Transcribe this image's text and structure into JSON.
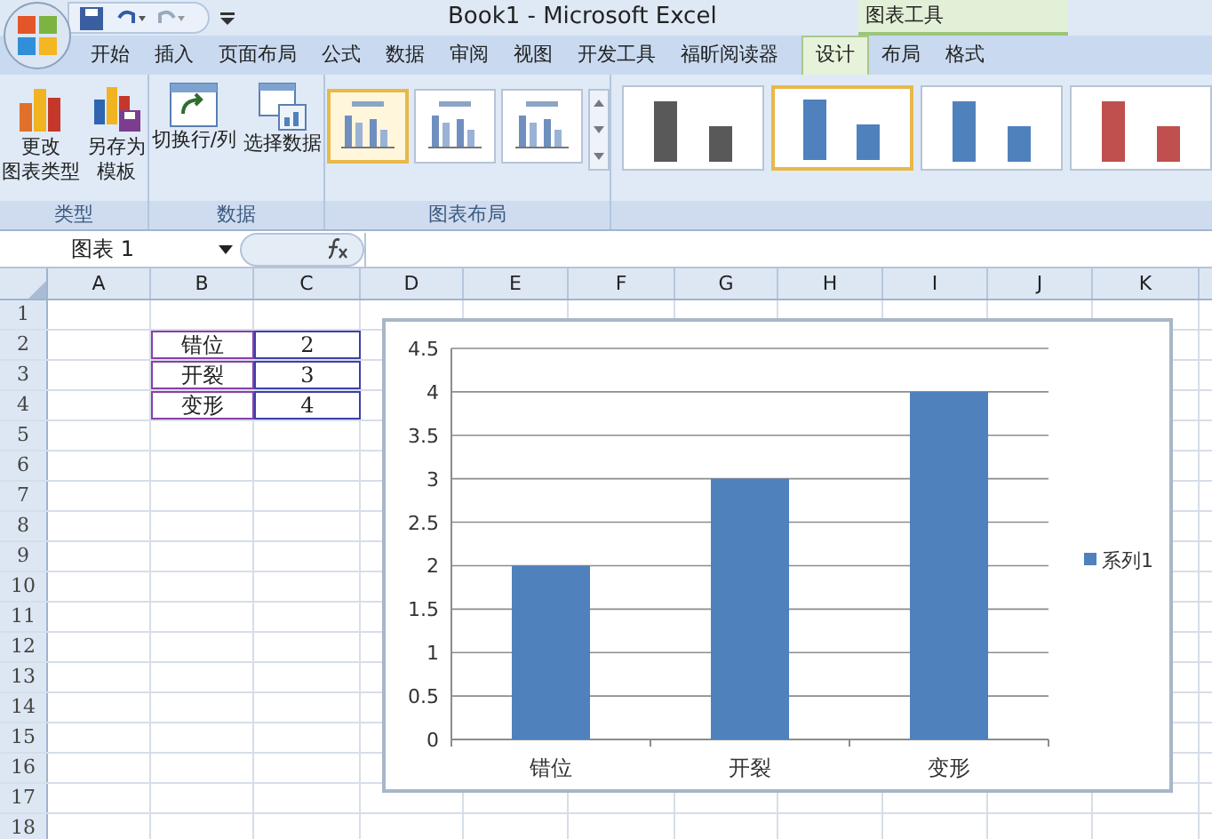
{
  "window": {
    "title": "Book1 - Microsoft Excel"
  },
  "context_tab_group": "图表工具",
  "ribbon_tabs": [
    {
      "label": "开始",
      "selected": false
    },
    {
      "label": "插入",
      "selected": false
    },
    {
      "label": "页面布局",
      "selected": false
    },
    {
      "label": "公式",
      "selected": false
    },
    {
      "label": "数据",
      "selected": false
    },
    {
      "label": "审阅",
      "selected": false
    },
    {
      "label": "视图",
      "selected": false
    },
    {
      "label": "开发工具",
      "selected": false
    },
    {
      "label": "福昕阅读器",
      "selected": false
    },
    {
      "label": "设计",
      "selected": true
    },
    {
      "label": "布局",
      "selected": false
    },
    {
      "label": "格式",
      "selected": false
    }
  ],
  "ribbon_groups": [
    {
      "label": "类型",
      "buttons": [
        {
          "kind": "chart-type",
          "lines": [
            "更改",
            "图表类型"
          ]
        },
        {
          "kind": "template",
          "lines": [
            "另存为",
            "模板"
          ]
        }
      ]
    },
    {
      "label": "数据",
      "buttons": [
        {
          "kind": "switch",
          "lines": [
            "切换行/列"
          ]
        },
        {
          "kind": "select",
          "lines": [
            "选择数据"
          ]
        }
      ]
    },
    {
      "label": "图表布局",
      "layouts": [
        {
          "selected": true
        },
        {
          "selected": false
        },
        {
          "selected": false
        }
      ]
    }
  ],
  "chart_styles": [
    {
      "color": "#595959",
      "selected": false
    },
    {
      "color": "#4f81bd",
      "selected": true
    },
    {
      "color": "#4f81bd",
      "selected": false
    },
    {
      "color": "#c0504d",
      "selected": false
    }
  ],
  "name_box": "图表 1",
  "columns": [
    "A",
    "B",
    "C",
    "D",
    "E",
    "F",
    "G",
    "H",
    "I",
    "J",
    "K"
  ],
  "row_numbers": [
    "1",
    "2",
    "3",
    "4",
    "5",
    "6",
    "7",
    "8",
    "9",
    "10",
    "11",
    "12",
    "13",
    "14",
    "15",
    "16",
    "17",
    "18"
  ],
  "data_rows": [
    [
      "错位",
      "2"
    ],
    [
      "开裂",
      "3"
    ],
    [
      "变形",
      "4"
    ]
  ],
  "chart": {
    "chart_data": {
      "type": "bar",
      "categories": [
        "错位",
        "开裂",
        "变形"
      ],
      "series": [
        {
          "name": "系列1",
          "color": "#4f81bd",
          "values": [
            2,
            3,
            4
          ]
        }
      ],
      "grid": true,
      "ylim": [
        0,
        4.5
      ],
      "yticks": [
        0,
        0.5,
        1,
        1.5,
        2,
        2.5,
        3,
        3.5,
        4,
        4.5
      ]
    }
  }
}
